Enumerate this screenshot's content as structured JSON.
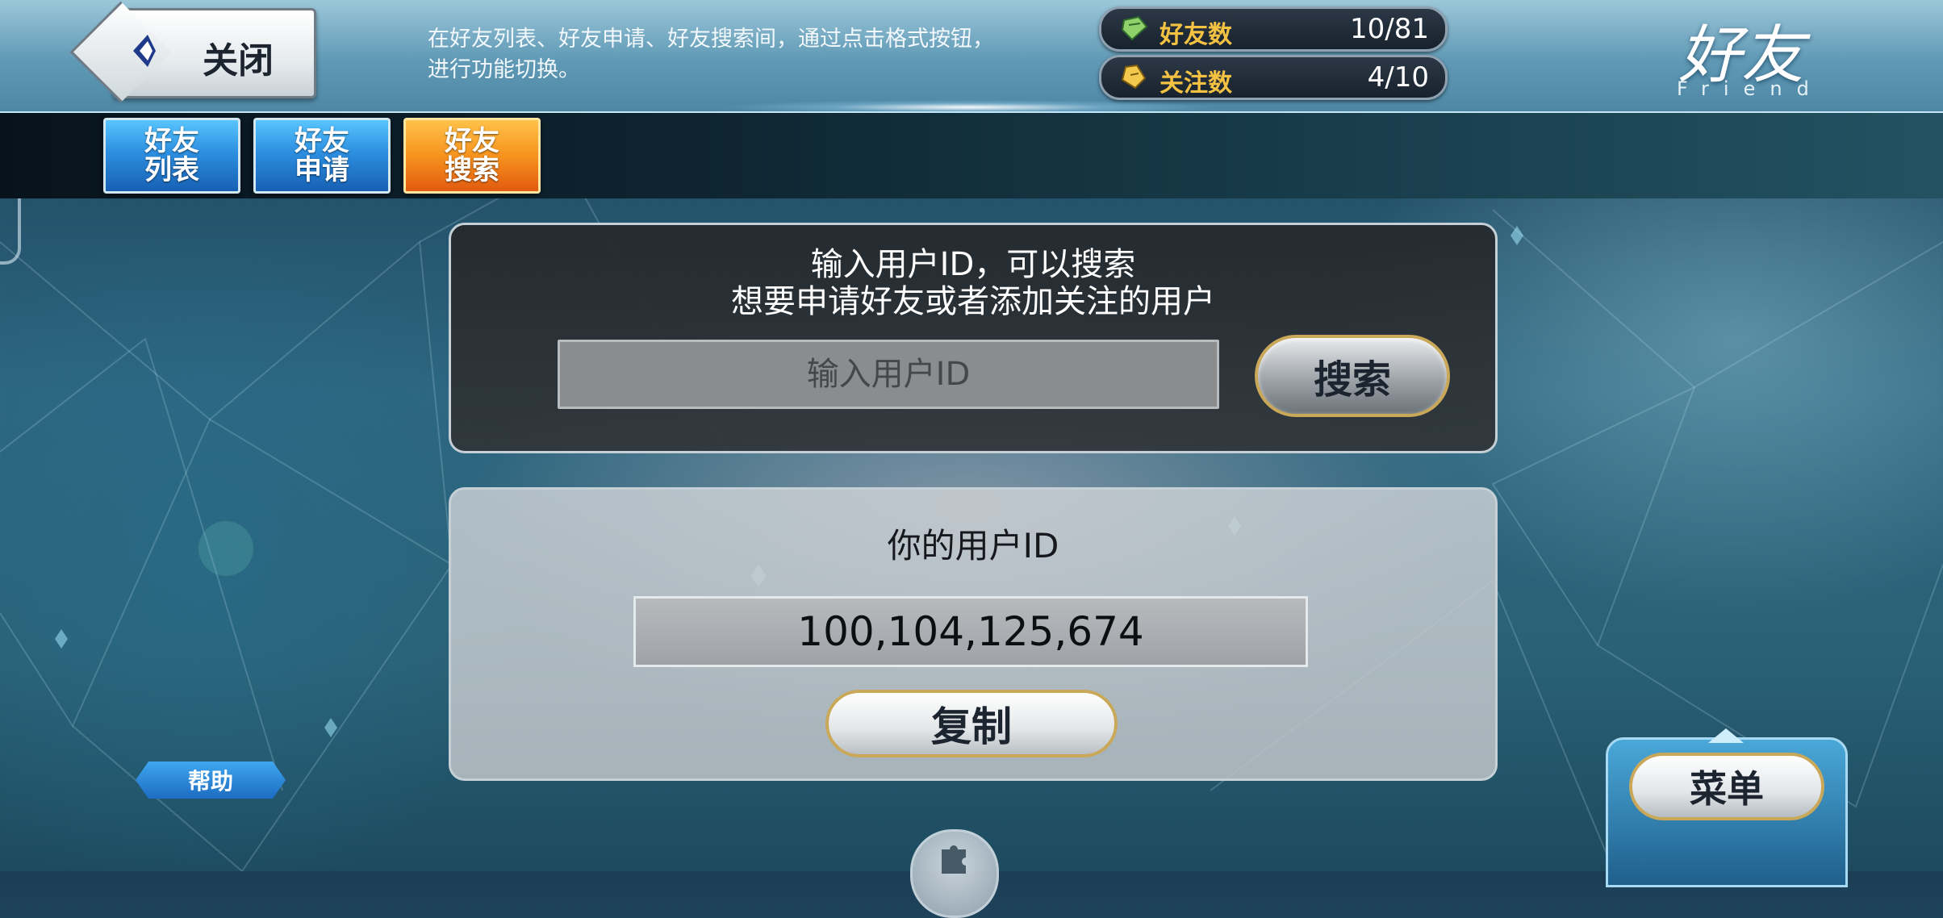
{
  "header": {
    "close_label": "关闭",
    "hint_line1": "在好友列表、好友申请、好友搜索间，通过点击格式按钮，",
    "hint_line2": "进行功能切换。",
    "friend_count_label": "好友数",
    "friend_count_value": "10/81",
    "follow_count_label": "关注数",
    "follow_count_value": "4/10",
    "title": "好友",
    "subtitle": "Friend",
    "friend_count_icon": "friend-count-icon",
    "follow_count_icon": "follow-count-icon"
  },
  "tabs": [
    {
      "line1": "好友",
      "line2": "列表",
      "active": false
    },
    {
      "line1": "好友",
      "line2": "申请",
      "active": false
    },
    {
      "line1": "好友",
      "line2": "搜索",
      "active": true
    }
  ],
  "search": {
    "prompt_line1": "输入用户ID，可以搜索",
    "prompt_line2": "想要申请好友或者添加关注的用户",
    "placeholder": "输入用户ID",
    "value": "",
    "button_label": "搜索"
  },
  "user_id": {
    "title": "你的用户ID",
    "value": "100,104,125,674",
    "copy_label": "复制"
  },
  "footer": {
    "help_label": "帮助",
    "menu_label": "菜单"
  },
  "colors": {
    "tab_active": "#f7931d",
    "tab_inactive": "#2d8fe0",
    "stat_label": "#f3c242",
    "button_border": "#c9a85a"
  }
}
